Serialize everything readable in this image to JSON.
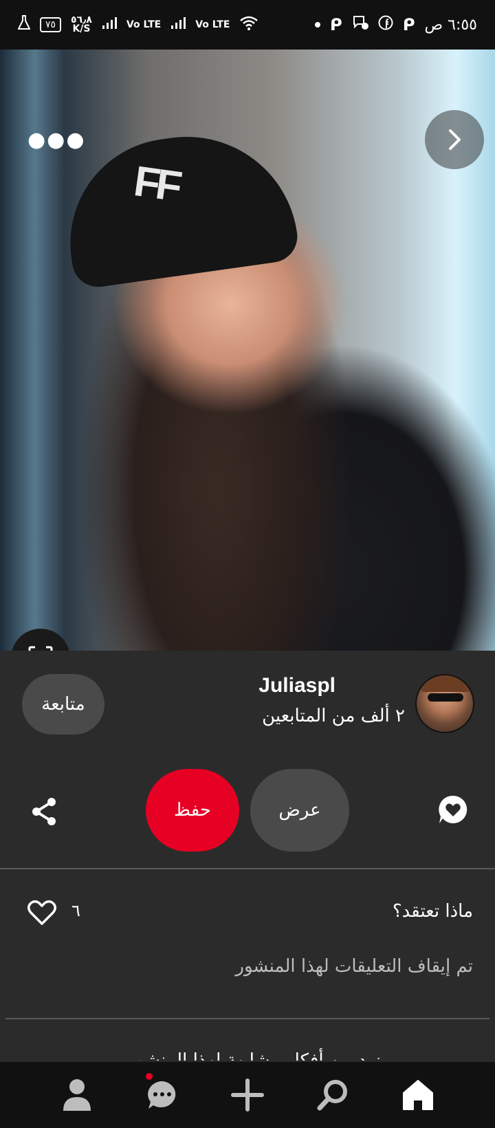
{
  "status_bar": {
    "time": "٦:٥٥ ص",
    "battery": "٧٥",
    "speed_value": "٥٦٫٨",
    "speed_unit": "K/S",
    "volte_1": "Vo LTE",
    "volte_2": "Vo LTE",
    "icons": [
      "flask-icon",
      "battery-icon",
      "signal-icon",
      "signal-icon",
      "wifi-icon",
      "dot-icon",
      "p-app-icon",
      "messenger-icon",
      "facebook-icon",
      "p-app-icon"
    ]
  },
  "photo": {
    "cap_logo": "FF",
    "more_icon": "more-horizontal-icon",
    "next_icon": "chevron-right-icon",
    "lens_icon": "visual-search-icon"
  },
  "creator": {
    "name": "Juliaspl",
    "followers": "٢ ألف من المتابعين",
    "follow_label": "متابعة"
  },
  "actions": {
    "save_label": "حفظ",
    "view_label": "عرض",
    "share_icon": "share-icon",
    "comment_icon": "comment-icon"
  },
  "comments": {
    "question": "ماذا تعتقد؟",
    "like_count": "٦",
    "disabled_text": "تم إيقاف التعليقات لهذا المنشور",
    "more_text": "مزيد من أفكار مشابهة لهذا المنشور"
  },
  "nav": {
    "items": [
      "profile-icon",
      "messages-icon",
      "create-icon",
      "search-icon",
      "home-icon"
    ]
  },
  "colors": {
    "accent": "#e60023",
    "background": "#2b2b2b",
    "pill": "#4a4a4a"
  }
}
